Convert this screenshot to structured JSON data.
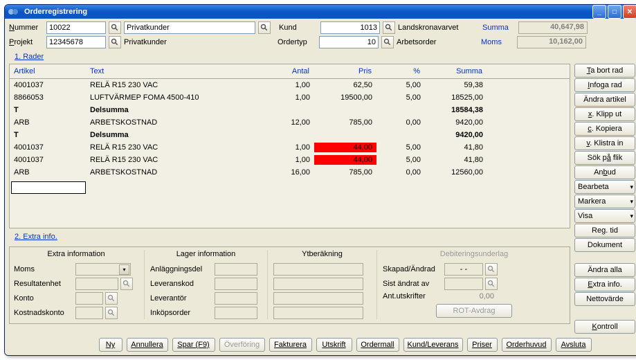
{
  "window": {
    "title": "Orderregistrering"
  },
  "header": {
    "nummer_label": "Nummer",
    "nummer": "10022",
    "nummer_lookup_text": "Privatkunder",
    "projekt_label": "Projekt",
    "projekt": "12345678",
    "projekt_lookup_text": "Privatkunder",
    "kund_label": "Kund",
    "kund": "1013",
    "kund_name": "Landskronavarvet",
    "ordertyp_label": "Ordertyp",
    "ordertyp": "10",
    "ordertyp_name": "Arbetsorder",
    "summa_label": "Summa",
    "summa": "40,647,98",
    "moms_label": "Moms",
    "moms": "10,162,00"
  },
  "sections": {
    "rader": "1. Rader",
    "extra": "2. Extra info."
  },
  "grid": {
    "headers": {
      "artikel": "Artikel",
      "text": "Text",
      "antal": "Antal",
      "pris": "Pris",
      "procent": "%",
      "summa": "Summa"
    },
    "rows": [
      {
        "artikel": "4001037",
        "text": "RELÄ R15 230 VAC",
        "antal": "1,00",
        "pris": "62,50",
        "procent": "5,00",
        "summa": "59,38"
      },
      {
        "artikel": "8866053",
        "text": "LUFTVÄRMEP FOMA 4500-410",
        "antal": "1,00",
        "pris": "19500,00",
        "procent": "5,00",
        "summa": "18525,00"
      },
      {
        "artikel": "T",
        "text": "Delsumma",
        "antal": "",
        "pris": "",
        "procent": "",
        "summa": "18584,38",
        "bold": true
      },
      {
        "artikel": "ARB",
        "text": "ARBETSKOSTNAD",
        "antal": "12,00",
        "pris": "785,00",
        "procent": "0,00",
        "summa": "9420,00"
      },
      {
        "artikel": "T",
        "text": "Delsumma",
        "antal": "",
        "pris": "",
        "procent": "",
        "summa": "9420,00",
        "bold": true
      },
      {
        "artikel": "4001037",
        "text": "RELÄ R15 230 VAC",
        "antal": "1,00",
        "pris": "44,00",
        "procent": "5,00",
        "summa": "41,80",
        "pris_red": true
      },
      {
        "artikel": "4001037",
        "text": "RELÄ R15 230 VAC",
        "antal": "1,00",
        "pris": "44,00",
        "procent": "5,00",
        "summa": "41,80",
        "pris_red": true
      },
      {
        "artikel": "ARB",
        "text": "ARBETSKOSTNAD",
        "antal": "16,00",
        "pris": "785,00",
        "procent": "0,00",
        "summa": "12560,00"
      }
    ]
  },
  "side": {
    "tabort": "Ta bort rad",
    "infoga": "Infoga rad",
    "andra_art": "Ändra artikel",
    "klipp": "x. Klipp ut",
    "kopiera": "c. Kopiera",
    "klistra": "v. Klistra in",
    "sokflik": "Sök på flik",
    "anbud": "Anbud",
    "bearbeta": "Bearbeta",
    "markera": "Markera",
    "visa": "Visa",
    "regtid": "Reg. tid",
    "dokument": "Dokument",
    "andra_alla": "Ändra alla",
    "extrainfo": "Extra info.",
    "nettovarde": "Nettovärde",
    "kontroll": "Kontroll"
  },
  "info": {
    "h1": "Extra information",
    "h2": "Lager information",
    "h3": "Ytberäkning",
    "h4": "Debiteringsunderlag",
    "moms": "Moms",
    "resultat": "Resultatenhet",
    "konto": "Konto",
    "kostnad": "Kostnadskonto",
    "anlagg": "Anläggningsdel",
    "levkod": "Leveranskod",
    "leverantor": "Leverantör",
    "inkop": "Inköpsorder",
    "skapad": "Skapad/Ändrad",
    "skapad_val": "- -",
    "sist": "Sist ändrat av",
    "antut": "Ant.utskrifter",
    "antut_val": "0,00",
    "rot": "ROT-Avdrag"
  },
  "footer": {
    "ny": "Ny",
    "annullera": "Annullera",
    "spar": "Spar (F9)",
    "overforing": "Överföring",
    "fakturera": "Fakturera",
    "utskrift": "Utskrift",
    "ordermall": "Ordermall",
    "kundlev": "Kund/Leverans",
    "priser": "Priser",
    "orderhuvud": "Orderhuvud",
    "avsluta": "Avsluta"
  }
}
